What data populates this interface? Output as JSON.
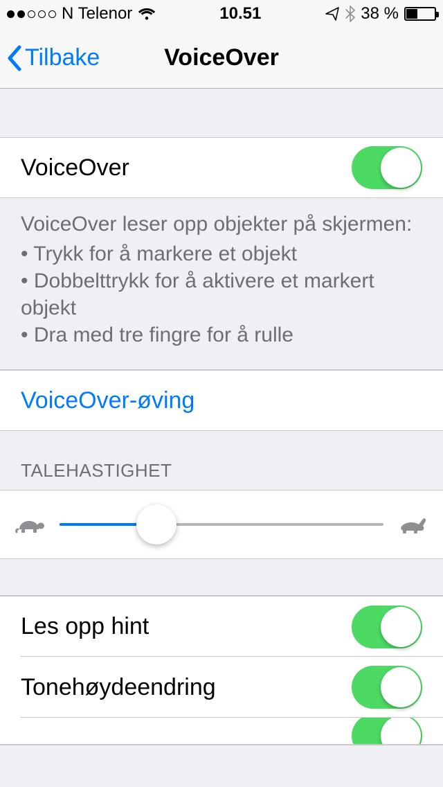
{
  "status": {
    "carrier": "N Telenor",
    "time": "10.51",
    "battery_pct": "38 %"
  },
  "nav": {
    "back_label": "Tilbake",
    "title": "VoiceOver"
  },
  "main_toggle": {
    "label": "VoiceOver",
    "on": true
  },
  "description": {
    "intro": "VoiceOver leser opp objekter på skjermen:",
    "bullets": [
      "Trykk for å markere et objekt",
      "Dobbelttrykk for å aktivere et markert objekt",
      "Dra med tre fingre for å rulle"
    ]
  },
  "practice_link": "VoiceOver-øving",
  "speed": {
    "header": "TALEHASTIGHET",
    "value_pct": 30
  },
  "options": [
    {
      "label": "Les opp hint",
      "on": true
    },
    {
      "label": "Tonehøydeendring",
      "on": true
    }
  ]
}
